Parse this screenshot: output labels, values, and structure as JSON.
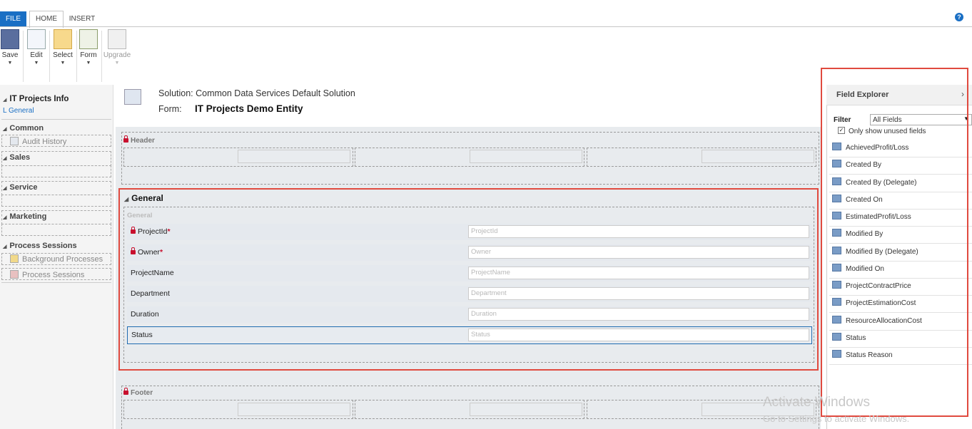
{
  "tabs": {
    "file": "FILE",
    "home": "HOME",
    "insert": "INSERT"
  },
  "help": "?",
  "ribbon": [
    {
      "label": "Save"
    },
    {
      "label": "Edit"
    },
    {
      "label": "Select"
    },
    {
      "label": "Form"
    },
    {
      "label": "Upgrade"
    }
  ],
  "nav": {
    "entity": "IT Projects Info",
    "current": "General",
    "sections": {
      "common": "Common",
      "audit_history": "Audit History",
      "sales": "Sales",
      "service": "Service",
      "marketing": "Marketing",
      "process_sessions": "Process Sessions",
      "background_processes": "Background Processes",
      "process_sessions_item": "Process Sessions"
    }
  },
  "solution": {
    "text": "Solution: Common Data Services Default Solution",
    "form_label": "Form:",
    "form_name": "IT Projects Demo Entity"
  },
  "header": {
    "title": "Header"
  },
  "footer": {
    "title": "Footer"
  },
  "general": {
    "tab_title": "General",
    "section_title": "General",
    "fields": [
      {
        "label": "ProjectId",
        "placeholder": "ProjectId",
        "required": true,
        "locked": true
      },
      {
        "label": "Owner",
        "placeholder": "Owner",
        "required": true,
        "locked": true
      },
      {
        "label": "ProjectName",
        "placeholder": "ProjectName"
      },
      {
        "label": "Department",
        "placeholder": "Department"
      },
      {
        "label": "Duration",
        "placeholder": "Duration"
      },
      {
        "label": "Status",
        "placeholder": "Status",
        "selected": true
      }
    ],
    "required_mark": "*"
  },
  "field_explorer": {
    "title": "Field Explorer",
    "filter_label": "Filter",
    "filter_value": "All Fields",
    "only_unused_label": "Only show unused fields",
    "only_unused_checked": true,
    "fields": [
      "AchievedProfit/Loss",
      "Created By",
      "Created By (Delegate)",
      "Created On",
      "EstimatedProfit/Loss",
      "Modified By",
      "Modified By (Delegate)",
      "Modified On",
      "ProjectContractPrice",
      "ProjectEstimationCost",
      "ResourceAllocationCost",
      "Status",
      "Status Reason"
    ]
  },
  "watermark": {
    "line1": "Activate Windows",
    "line2": "Go to Settings to activate Windows."
  },
  "colors": {
    "accent": "#1a6fc4",
    "highlight_box": "#e04a3f",
    "required": "#c8102e"
  }
}
